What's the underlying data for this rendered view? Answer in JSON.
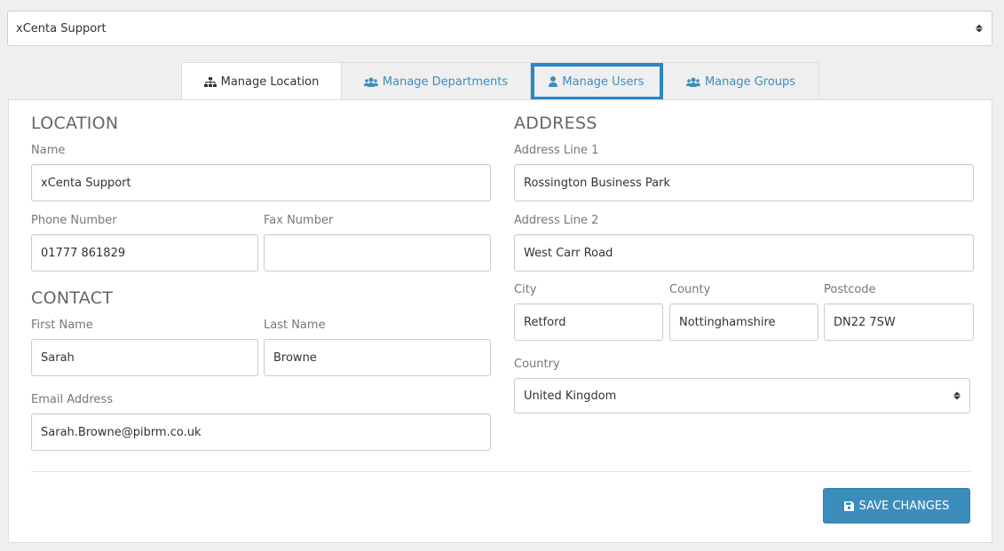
{
  "top_select": {
    "value": "xCenta Support"
  },
  "tabs": [
    {
      "label": "Manage Location",
      "icon": "sitemap-icon"
    },
    {
      "label": "Manage Departments",
      "icon": "users-group-icon"
    },
    {
      "label": "Manage Users",
      "icon": "user-icon"
    },
    {
      "label": "Manage Groups",
      "icon": "users-group-icon"
    }
  ],
  "location": {
    "title": "LOCATION",
    "name_label": "Name",
    "name_value": "xCenta Support",
    "phone_label": "Phone Number",
    "phone_value": "01777 861829",
    "fax_label": "Fax Number",
    "fax_value": ""
  },
  "contact": {
    "title": "CONTACT",
    "first_label": "First Name",
    "first_value": "Sarah",
    "last_label": "Last Name",
    "last_value": "Browne",
    "email_label": "Email Address",
    "email_value": "Sarah.Browne@pibrm.co.uk"
  },
  "address": {
    "title": "ADDRESS",
    "line1_label": "Address Line 1",
    "line1_value": "Rossington Business Park",
    "line2_label": "Address Line 2",
    "line2_value": "West Carr Road",
    "city_label": "City",
    "city_value": "Retford",
    "county_label": "County",
    "county_value": "Nottinghamshire",
    "postcode_label": "Postcode",
    "postcode_value": "DN22 7SW",
    "country_label": "Country",
    "country_value": "United Kingdom"
  },
  "save_button": {
    "label": "SAVE CHANGES",
    "icon": "floppy-disk-icon"
  },
  "colors": {
    "accent": "#3c8dbc",
    "highlight": "#2a87c6"
  }
}
